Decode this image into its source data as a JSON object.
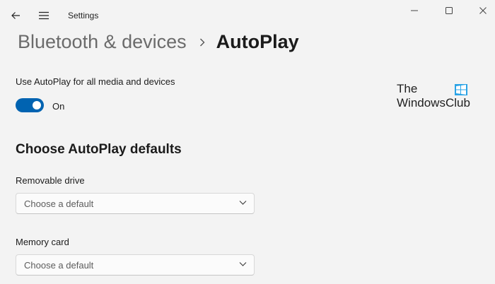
{
  "titlebar": {
    "app_title": "Settings",
    "back_icon": "back-arrow-icon",
    "menu_icon": "hamburger-menu-icon",
    "window_controls": [
      "minimize-icon",
      "maximize-icon",
      "close-icon"
    ]
  },
  "breadcrumb": {
    "parent": "Bluetooth & devices",
    "current": "AutoPlay"
  },
  "autoplay_toggle": {
    "label": "Use AutoPlay for all media and devices",
    "state_text": "On",
    "on": true,
    "accent": "#0063b1"
  },
  "watermark": {
    "line1": "The",
    "line2": "WindowsClub",
    "icon": "windows-logo-icon"
  },
  "defaults": {
    "title": "Choose AutoPlay defaults",
    "fields": [
      {
        "label": "Removable drive",
        "value": "Choose a default"
      },
      {
        "label": "Memory card",
        "value": "Choose a default"
      }
    ]
  }
}
